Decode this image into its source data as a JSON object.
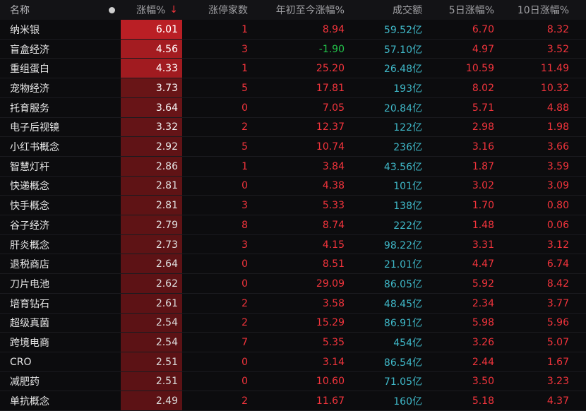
{
  "header": {
    "name": "名称",
    "change_pct": "涨幅%",
    "limit_up_count": "涨停家数",
    "ytd_change": "年初至今涨幅%",
    "volume": "成交额",
    "d5_change": "5日涨幅%",
    "d10_change": "10日涨幅%"
  },
  "colors": {
    "up": "#f2343c",
    "down": "#22c24a",
    "volume": "#3fb8c8",
    "bar_strong": "#9b1a1f",
    "bar_weak": "#6b1518"
  },
  "rows": [
    {
      "name": "纳米银",
      "chg": "6.01",
      "lim": "1",
      "ytd": "8.94",
      "vol": "59.52亿",
      "d5": "6.70",
      "d10": "8.32"
    },
    {
      "name": "盲盒经济",
      "chg": "4.56",
      "lim": "3",
      "ytd": "-1.90",
      "vol": "57.10亿",
      "d5": "4.97",
      "d10": "3.52"
    },
    {
      "name": "重组蛋白",
      "chg": "4.33",
      "lim": "1",
      "ytd": "25.20",
      "vol": "26.48亿",
      "d5": "10.59",
      "d10": "11.49"
    },
    {
      "name": "宠物经济",
      "chg": "3.73",
      "lim": "5",
      "ytd": "17.81",
      "vol": "193亿",
      "d5": "8.02",
      "d10": "10.32"
    },
    {
      "name": "托育服务",
      "chg": "3.64",
      "lim": "0",
      "ytd": "7.05",
      "vol": "20.84亿",
      "d5": "5.71",
      "d10": "4.88"
    },
    {
      "name": "电子后视镜",
      "chg": "3.32",
      "lim": "2",
      "ytd": "12.37",
      "vol": "122亿",
      "d5": "2.98",
      "d10": "1.98"
    },
    {
      "name": "小红书概念",
      "chg": "2.92",
      "lim": "5",
      "ytd": "10.74",
      "vol": "236亿",
      "d5": "3.16",
      "d10": "3.66"
    },
    {
      "name": "智慧灯杆",
      "chg": "2.86",
      "lim": "1",
      "ytd": "3.84",
      "vol": "43.56亿",
      "d5": "1.87",
      "d10": "3.59"
    },
    {
      "name": "快递概念",
      "chg": "2.81",
      "lim": "0",
      "ytd": "4.38",
      "vol": "101亿",
      "d5": "3.02",
      "d10": "3.09"
    },
    {
      "name": "快手概念",
      "chg": "2.81",
      "lim": "3",
      "ytd": "5.33",
      "vol": "138亿",
      "d5": "1.70",
      "d10": "0.80"
    },
    {
      "name": "谷子经济",
      "chg": "2.79",
      "lim": "8",
      "ytd": "8.74",
      "vol": "222亿",
      "d5": "1.48",
      "d10": "0.06"
    },
    {
      "name": "肝炎概念",
      "chg": "2.73",
      "lim": "3",
      "ytd": "4.15",
      "vol": "98.22亿",
      "d5": "3.31",
      "d10": "3.12"
    },
    {
      "name": "退税商店",
      "chg": "2.64",
      "lim": "0",
      "ytd": "8.51",
      "vol": "21.01亿",
      "d5": "4.47",
      "d10": "6.74"
    },
    {
      "name": "刀片电池",
      "chg": "2.62",
      "lim": "0",
      "ytd": "29.09",
      "vol": "86.05亿",
      "d5": "5.92",
      "d10": "8.42"
    },
    {
      "name": "培育钻石",
      "chg": "2.61",
      "lim": "2",
      "ytd": "3.58",
      "vol": "48.45亿",
      "d5": "2.34",
      "d10": "3.77"
    },
    {
      "name": "超级真菌",
      "chg": "2.54",
      "lim": "2",
      "ytd": "15.29",
      "vol": "86.91亿",
      "d5": "5.98",
      "d10": "5.96"
    },
    {
      "name": "跨境电商",
      "chg": "2.54",
      "lim": "7",
      "ytd": "5.35",
      "vol": "454亿",
      "d5": "3.26",
      "d10": "5.07"
    },
    {
      "name": "CRO",
      "chg": "2.51",
      "lim": "0",
      "ytd": "3.14",
      "vol": "86.54亿",
      "d5": "2.44",
      "d10": "1.67"
    },
    {
      "name": "减肥药",
      "chg": "2.51",
      "lim": "0",
      "ytd": "10.60",
      "vol": "71.05亿",
      "d5": "3.50",
      "d10": "3.23"
    },
    {
      "name": "单抗概念",
      "chg": "2.49",
      "lim": "2",
      "ytd": "11.67",
      "vol": "160亿",
      "d5": "5.18",
      "d10": "4.37"
    }
  ]
}
